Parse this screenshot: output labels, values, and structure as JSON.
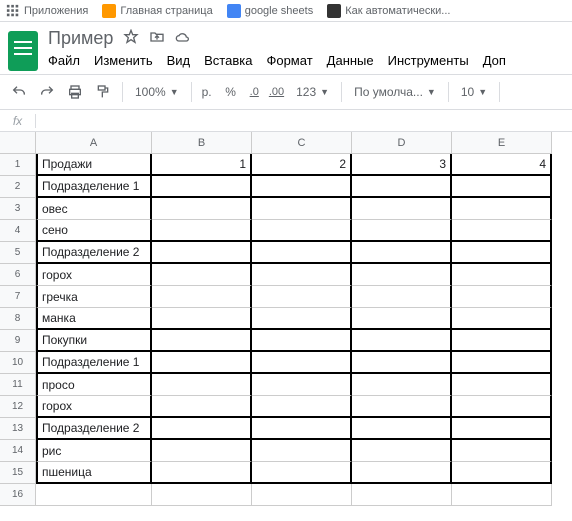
{
  "bookmarks": {
    "apps": "Приложения",
    "b1": "Главная страница",
    "b2": "google sheets",
    "b3": "Как автоматически..."
  },
  "doc": {
    "title": "Пример"
  },
  "menu": {
    "file": "Файл",
    "edit": "Изменить",
    "view": "Вид",
    "insert": "Вставка",
    "format": "Формат",
    "data": "Данные",
    "tools": "Инструменты",
    "add": "Доп"
  },
  "toolbar": {
    "zoom": "100%",
    "currency": "р.",
    "percent": "%",
    "dec_dec": ".0",
    "dec_inc": ".00",
    "numfmt": "123",
    "font": "По умолча...",
    "fontsize": "10"
  },
  "fx": {
    "label": "fx",
    "value": ""
  },
  "columns": [
    "A",
    "B",
    "C",
    "D",
    "E"
  ],
  "rows": [
    "1",
    "2",
    "3",
    "4",
    "5",
    "6",
    "7",
    "8",
    "9",
    "10",
    "11",
    "12",
    "13",
    "14",
    "15",
    "16"
  ],
  "cells": {
    "r1": {
      "A": "Продажи",
      "B": "1",
      "C": "2",
      "D": "3",
      "E": "4"
    },
    "r2": {
      "A": "Подразделение 1"
    },
    "r3": {
      "A": "овес"
    },
    "r4": {
      "A": "сено"
    },
    "r5": {
      "A": "Подразделение 2"
    },
    "r6": {
      "A": "горох"
    },
    "r7": {
      "A": "гречка"
    },
    "r8": {
      "A": "манка"
    },
    "r9": {
      "A": "Покупки"
    },
    "r10": {
      "A": "Подразделение 1"
    },
    "r11": {
      "A": "просо"
    },
    "r12": {
      "A": "горох"
    },
    "r13": {
      "A": "Подразделение 2"
    },
    "r14": {
      "A": "рис"
    },
    "r15": {
      "A": "пшеница"
    }
  }
}
